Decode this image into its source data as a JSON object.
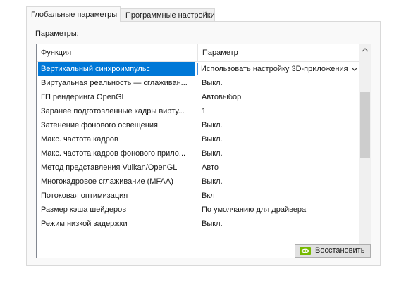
{
  "tabs": [
    {
      "label": "Глобальные параметры",
      "active": true
    },
    {
      "label": "Программные настройки",
      "active": false
    }
  ],
  "settings_label": "Параметры:",
  "columns": {
    "function": "Функция",
    "parameter": "Параметр"
  },
  "rows": [
    {
      "function": "Вертикальный синхроимпульс",
      "parameter": "Использовать настройку 3D-приложения",
      "selected": true
    },
    {
      "function": "Виртуальная реальность — сглаживан...",
      "parameter": "Выкл."
    },
    {
      "function": "ГП рендеринга OpenGL",
      "parameter": "Автовыбор"
    },
    {
      "function": "Заранее подготовленные кадры вирту...",
      "parameter": "1"
    },
    {
      "function": "Затенение фонового освещения",
      "parameter": "Выкл."
    },
    {
      "function": "Макс. частота кадров",
      "parameter": "Выкл."
    },
    {
      "function": "Макс. частота кадров фонового прило...",
      "parameter": "Выкл."
    },
    {
      "function": "Метод представления Vulkan/OpenGL",
      "parameter": "Авто"
    },
    {
      "function": "Многокадровое сглаживание (MFAA)",
      "parameter": "Выкл."
    },
    {
      "function": "Потоковая оптимизация",
      "parameter": "Вкл"
    },
    {
      "function": "Размер кэша шейдеров",
      "parameter": "По умолчанию для драйвера"
    },
    {
      "function": "Режим низкой задержки",
      "parameter": "Выкл."
    }
  ],
  "reset_button": {
    "label": "Восстановить",
    "icon": "nvidia-logo-icon"
  },
  "colors": {
    "selection": "#0078d7",
    "panel_bg": "#f9f9f9",
    "grid_border": "#828790",
    "scroll_thumb": "#cdcdcd",
    "nvidia_green": "#76b900"
  }
}
